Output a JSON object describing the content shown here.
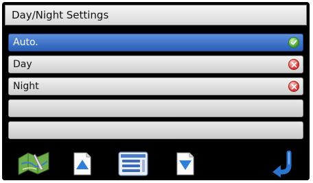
{
  "window": {
    "title": "Day/Night Settings"
  },
  "options": [
    {
      "label": "Auto.",
      "selected": true,
      "status": "check-icon"
    },
    {
      "label": "Day",
      "selected": false,
      "status": "error-icon"
    },
    {
      "label": "Night",
      "selected": false,
      "status": "error-icon"
    }
  ],
  "toolbar": {
    "buttons": [
      {
        "icon": "map-icon"
      },
      {
        "icon": "scroll-up-icon"
      },
      {
        "icon": "list-menu-icon"
      },
      {
        "icon": "scroll-down-icon"
      },
      {
        "icon": "back-icon"
      }
    ]
  },
  "colors": {
    "selected_row": "#2a5fb7",
    "check_status": "#3fa02a",
    "error_status": "#d8322e"
  }
}
